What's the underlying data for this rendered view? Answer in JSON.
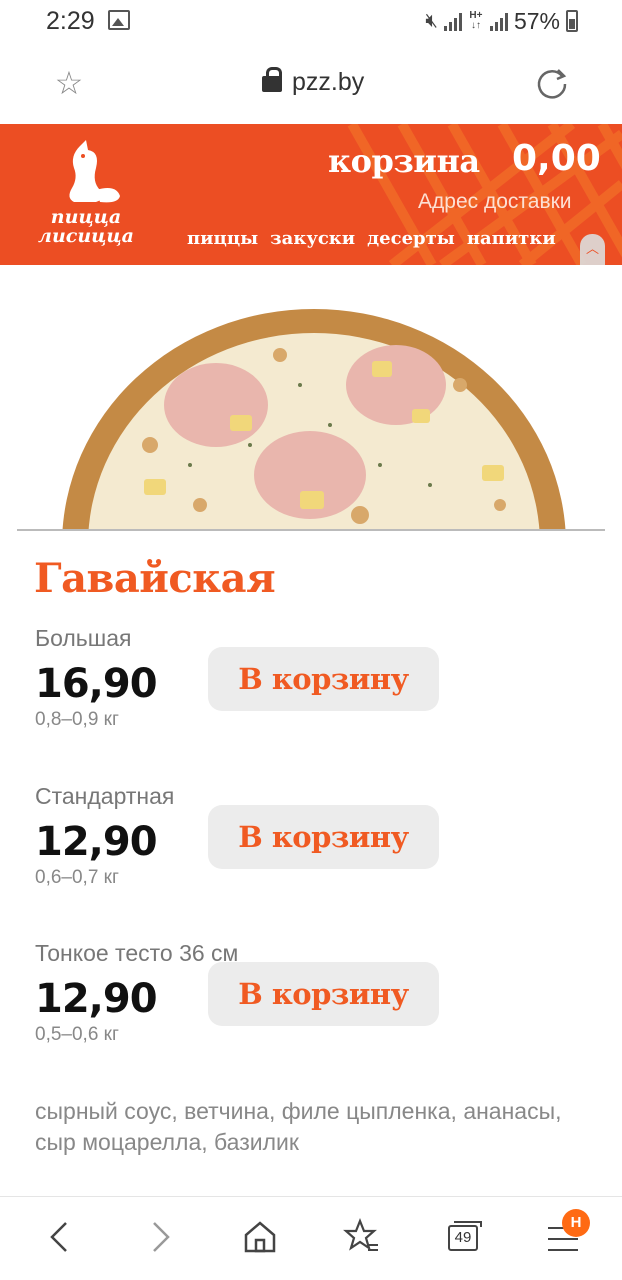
{
  "status_bar": {
    "time": "2:29",
    "net_type_top": "H+",
    "net_type_bottom": "↓↑",
    "battery_pct": "57%",
    "icons": [
      "image-icon",
      "mute-icon",
      "signal-icon",
      "battery-icon"
    ]
  },
  "browser": {
    "url": "pzz.by"
  },
  "header": {
    "logo_text_line1": "пицца",
    "logo_text_line2": "лисицца",
    "cart_label": "корзина",
    "cart_sum": "0,00",
    "address_label": "Адрес доставки",
    "nav": [
      "пиццы",
      "закуски",
      "десерты",
      "напитки"
    ],
    "brand_color": "#ec4e23"
  },
  "product": {
    "name": "Гавайская",
    "variants": [
      {
        "size": "Большая",
        "price": "16,90",
        "weight": "0,8–0,9 кг",
        "button": "В корзину"
      },
      {
        "size": "Стандартная",
        "price": "12,90",
        "weight": "0,6–0,7 кг",
        "button": "В корзину"
      },
      {
        "size": "Тонкое тесто 36 см",
        "price": "12,90",
        "weight": "0,5–0,6 кг",
        "button": "В корзину"
      }
    ],
    "ingredients": "сырный соус, ветчина, филе цыпленка, ананасы, сыр моцарелла, базилик"
  },
  "bottom_bar": {
    "tabs_count": "49",
    "menu_badge": "H"
  }
}
